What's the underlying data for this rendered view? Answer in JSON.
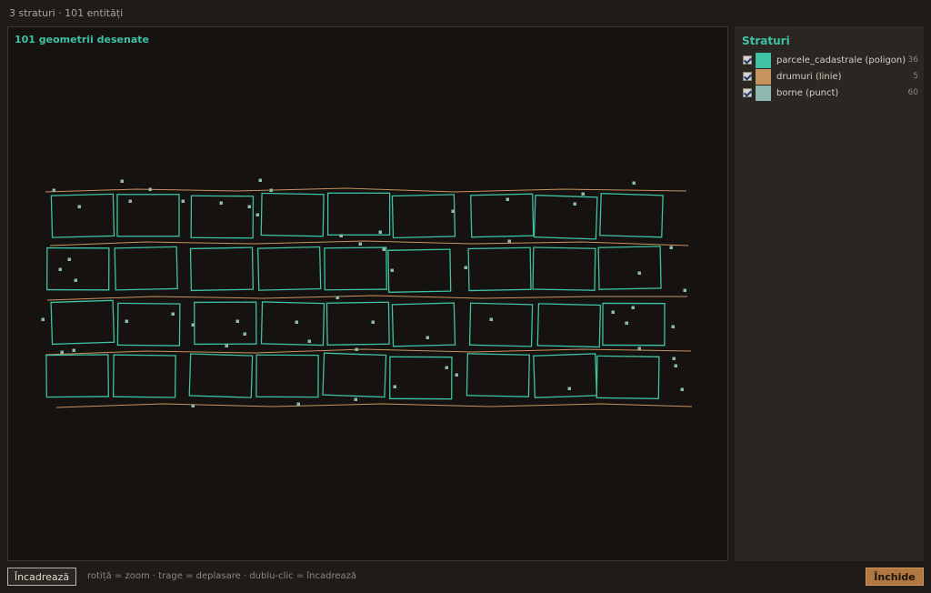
{
  "status": {
    "summary": "3 straturi · 101 entități"
  },
  "canvas": {
    "title": "101 geometrii desenate"
  },
  "panel": {
    "title": "Straturi",
    "layers": [
      {
        "name": "parcele_cadastrale (poligon)",
        "count": "36",
        "color": "#3fc1a5",
        "checked": true
      },
      {
        "name": "drumuri (linie)",
        "count": "5",
        "color": "#c9935f",
        "checked": true
      },
      {
        "name": "borne (punct)",
        "count": "60",
        "color": "#8fb8b0",
        "checked": true
      }
    ]
  },
  "footer": {
    "fit_label": "Încadrează",
    "hint": "rotiță = zoom · trage = deplasare · dublu-clic = încadrează",
    "close_label": "Închide"
  },
  "colors": {
    "polygon_stroke": "#3fc1a5",
    "road_stroke": "#c9935f",
    "point_fill": "#8fb8b0",
    "background": "#15120f",
    "accent_button": "#b07840"
  }
}
